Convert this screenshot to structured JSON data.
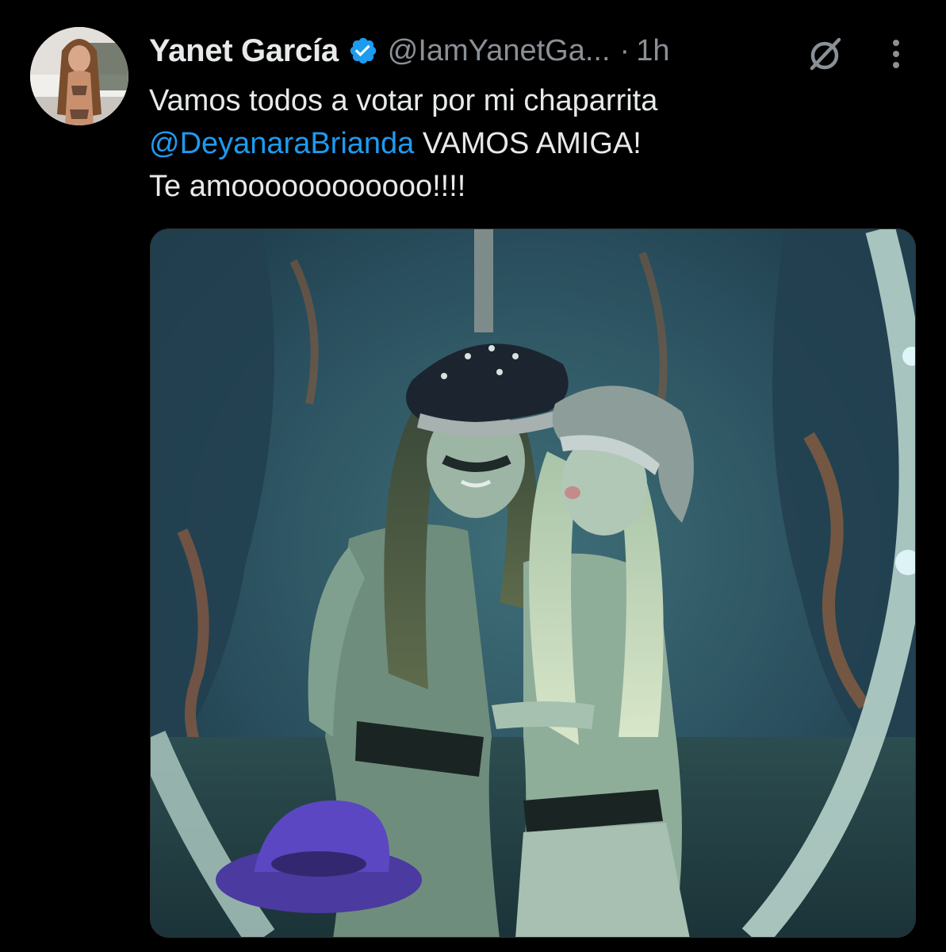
{
  "author": {
    "display_name": "Yanet García",
    "handle": "@IamYanetGa...",
    "separator": "·",
    "time": "1h",
    "verified": true,
    "avatar_icon": "profile-photo"
  },
  "actions": {
    "grok_icon": "grok-icon",
    "more_icon": "more-vertical-icon"
  },
  "tweet": {
    "line1": "Vamos todos a votar por mi chaparrita",
    "mention": "@DeyanaraBrianda",
    "line2_rest": " VAMOS AMIGA!",
    "line3": "Te amoooooooooooo!!!!"
  },
  "media": {
    "type": "photo",
    "description_icon": "photo-two-women-in-captain-hats"
  },
  "colors": {
    "background": "#000000",
    "text": "#e7e9ea",
    "secondary": "#8b9096",
    "link": "#1d9bf0",
    "verified": "#1d9bf0"
  }
}
